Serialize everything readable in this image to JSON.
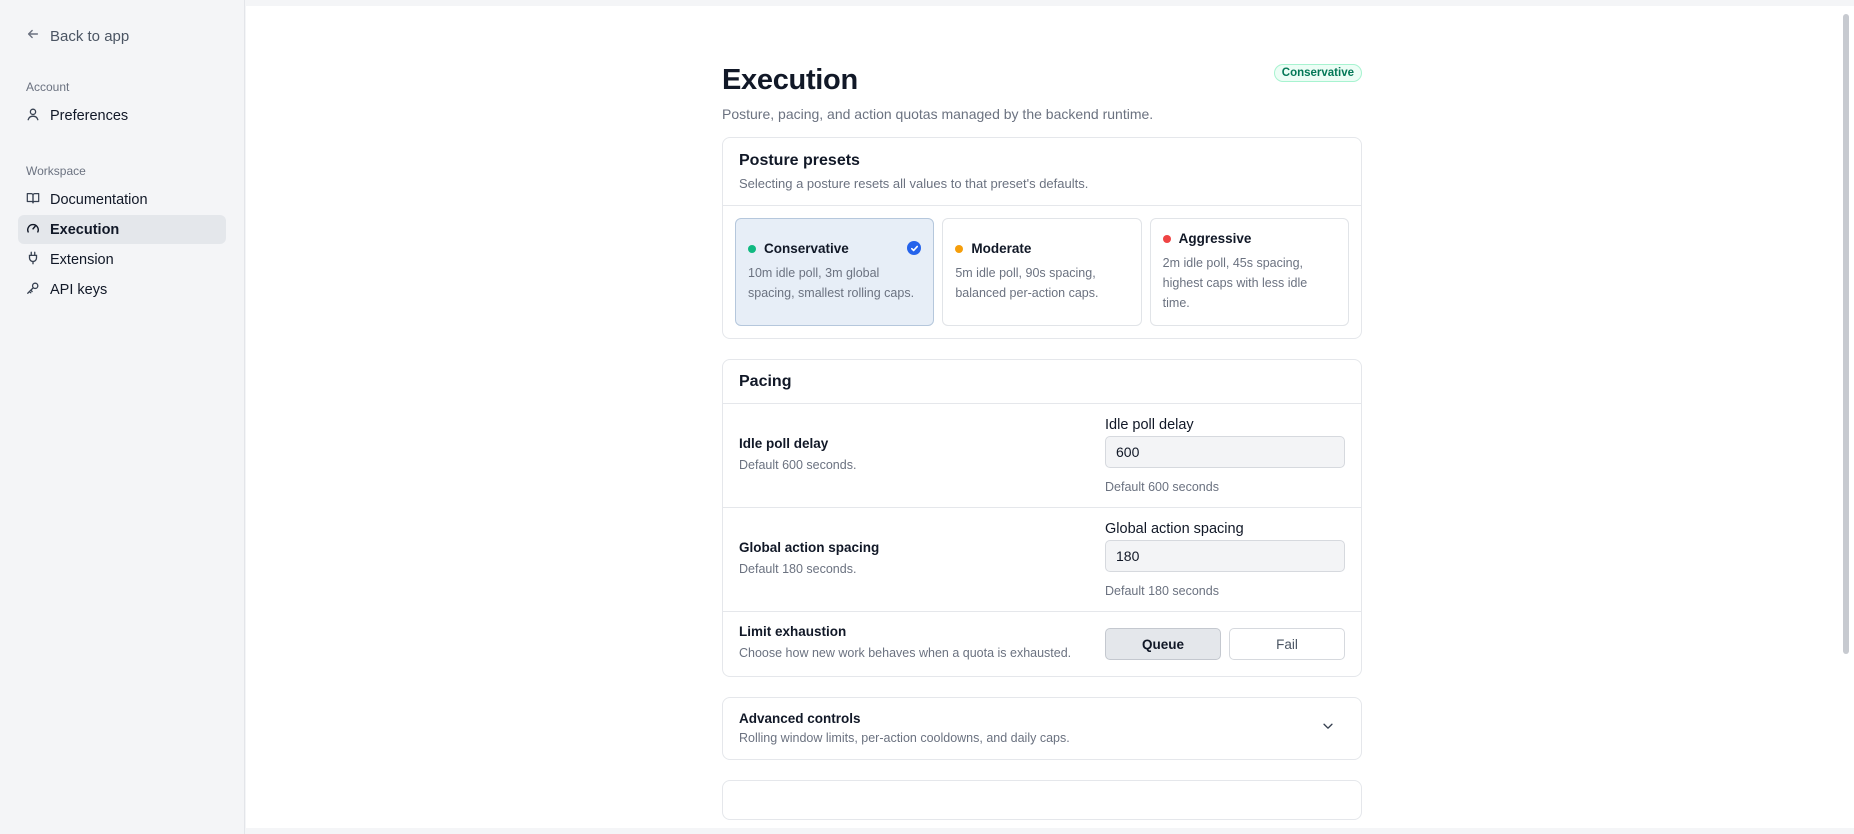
{
  "sidebar": {
    "back_label": "Back to app",
    "account_label": "Account",
    "account_items": [
      {
        "label": "Preferences",
        "icon": "user-icon"
      }
    ],
    "workspace_label": "Workspace",
    "workspace_items": [
      {
        "label": "Documentation",
        "icon": "book-icon"
      },
      {
        "label": "Execution",
        "icon": "gauge-icon",
        "active": true
      },
      {
        "label": "Extension",
        "icon": "plug-icon"
      },
      {
        "label": "API keys",
        "icon": "key-icon"
      }
    ]
  },
  "page": {
    "title": "Execution",
    "subtitle": "Posture, pacing, and action quotas managed by the backend runtime.",
    "badge": "Conservative"
  },
  "posture": {
    "title": "Posture presets",
    "description": "Selecting a posture resets all values to that preset's defaults.",
    "presets": [
      {
        "name": "Conservative",
        "description": "10m idle poll, 3m global spacing, smallest rolling caps.",
        "color": "#10b981",
        "selected": true
      },
      {
        "name": "Moderate",
        "description": "5m idle poll, 90s spacing, balanced per-action caps.",
        "color": "#f59e0b",
        "selected": false
      },
      {
        "name": "Aggressive",
        "description": "2m idle poll, 45s spacing, highest caps with less idle time.",
        "color": "#ef4444",
        "selected": false
      }
    ]
  },
  "pacing": {
    "title": "Pacing",
    "idle": {
      "title": "Idle poll delay",
      "description": "Default 600 seconds.",
      "field_label": "Idle poll delay",
      "value": "600",
      "hint": "Default 600 seconds"
    },
    "spacing": {
      "title": "Global action spacing",
      "description": "Default 180 seconds.",
      "field_label": "Global action spacing",
      "value": "180",
      "hint": "Default 180 seconds"
    },
    "limit": {
      "title": "Limit exhaustion",
      "description": "Choose how new work behaves when a quota is exhausted.",
      "options": [
        "Queue",
        "Fail"
      ],
      "selected": "Queue"
    }
  },
  "advanced": {
    "title": "Advanced controls",
    "description": "Rolling window limits, per-action cooldowns, and daily caps."
  }
}
